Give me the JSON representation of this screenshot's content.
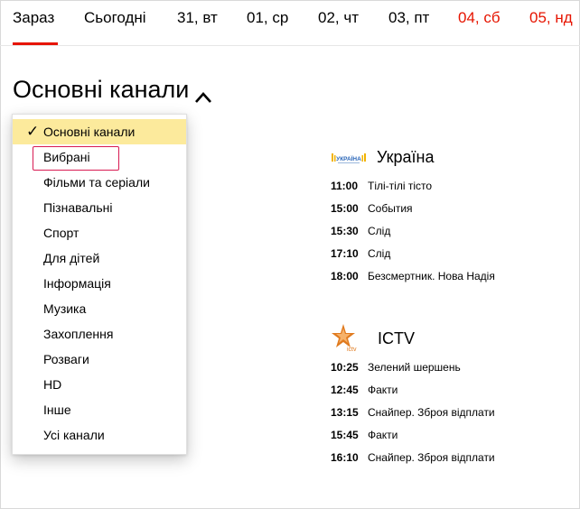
{
  "tabs": [
    {
      "label": "Зараз",
      "weekend": false,
      "active": true
    },
    {
      "label": "Сьогодні",
      "weekend": false,
      "active": false
    },
    {
      "label": "31, вт",
      "weekend": false,
      "active": false
    },
    {
      "label": "01, ср",
      "weekend": false,
      "active": false
    },
    {
      "label": "02, чт",
      "weekend": false,
      "active": false
    },
    {
      "label": "03, пт",
      "weekend": false,
      "active": false
    },
    {
      "label": "04, сб",
      "weekend": true,
      "active": false
    },
    {
      "label": "05, нд",
      "weekend": true,
      "active": false
    }
  ],
  "heading": {
    "title": "Основні канали",
    "icon": "chevron-up-icon"
  },
  "dropdown": {
    "check_icon": "✓",
    "items": [
      {
        "label": "Основні канали",
        "selected": true
      },
      {
        "label": "Вибрані",
        "selected": false,
        "focused": true
      },
      {
        "label": "Фільми та серіали",
        "selected": false
      },
      {
        "label": "Пізнавальні",
        "selected": false
      },
      {
        "label": "Спорт",
        "selected": false
      },
      {
        "label": "Для дітей",
        "selected": false
      },
      {
        "label": "Інформація",
        "selected": false
      },
      {
        "label": "Музика",
        "selected": false
      },
      {
        "label": "Захоплення",
        "selected": false
      },
      {
        "label": "Розваги",
        "selected": false
      },
      {
        "label": "HD",
        "selected": false
      },
      {
        "label": "Інше",
        "selected": false
      },
      {
        "label": "Усі канали",
        "selected": false
      }
    ]
  },
  "channels": [
    {
      "name": "Україна",
      "logo_icon": "ukraina-logo-icon",
      "logo_text": "УКРАЇНА",
      "programs": [
        {
          "time": "11:00",
          "title": "Тілі-тілі тісто"
        },
        {
          "time": "15:00",
          "title": "События"
        },
        {
          "time": "15:30",
          "title": "Слід"
        },
        {
          "time": "17:10",
          "title": "Слід"
        },
        {
          "time": "18:00",
          "title": "Безсмертник. Нова Надія"
        }
      ]
    },
    {
      "name": "ICTV",
      "logo_icon": "ictv-logo-icon",
      "logo_text": "ictv",
      "programs": [
        {
          "time": "10:25",
          "title": "Зелений шершень"
        },
        {
          "time": "12:45",
          "title": "Факти"
        },
        {
          "time": "13:15",
          "title": "Снайпер. Зброя відплати"
        },
        {
          "time": "15:45",
          "title": "Факти"
        },
        {
          "time": "16:10",
          "title": "Снайпер. Зброя відплати"
        }
      ]
    }
  ],
  "colors": {
    "accent": "#e61400",
    "selected_bg": "#fcea9c",
    "focus_border": "#d81b52",
    "ukraina_logo": "#f2b300",
    "ictv_logo": "#e07a1e"
  }
}
